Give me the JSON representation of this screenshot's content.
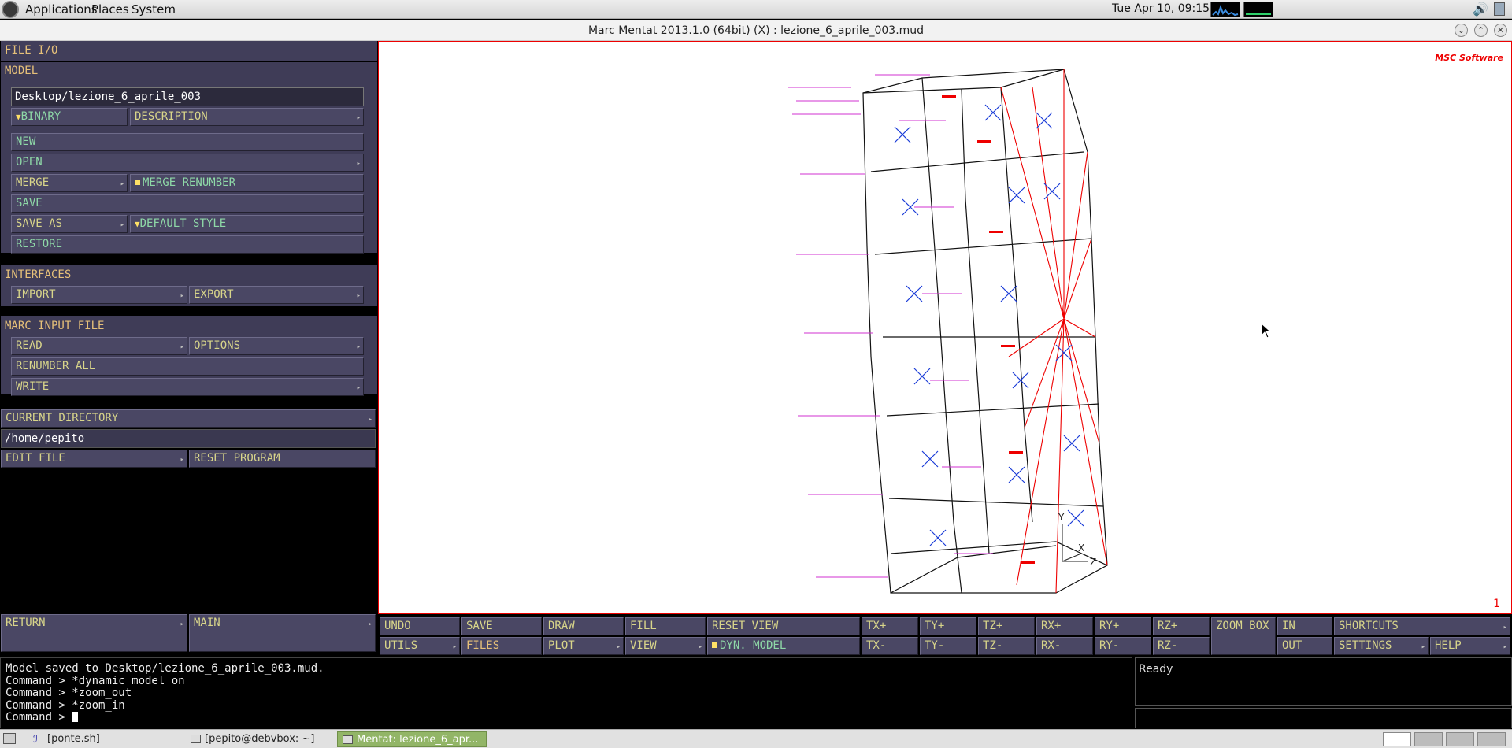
{
  "topbar": {
    "applications": "Applications",
    "places": "Places",
    "system": "System",
    "clock": "Tue Apr 10, 09:15"
  },
  "window": {
    "title": "Marc Mentat 2013.1.0 (64bit) (X) : lezione_6_aprile_003.mud"
  },
  "left": {
    "file_io": "FILE I/O",
    "model_header": "MODEL",
    "model_path": "Desktop/lezione_6_aprile_003",
    "binary": "BINARY",
    "description": "DESCRIPTION",
    "new": "NEW",
    "open": "OPEN",
    "merge": "MERGE",
    "merge_renumber": "MERGE RENUMBER",
    "save": "SAVE",
    "save_as": "SAVE AS",
    "default_style": "DEFAULT STYLE",
    "restore": "RESTORE",
    "interfaces_header": "INTERFACES",
    "import": "IMPORT",
    "export": "EXPORT",
    "marc_input_header": "MARC INPUT FILE",
    "read": "READ",
    "options": "OPTIONS",
    "renumber_all": "RENUMBER ALL",
    "write": "WRITE",
    "current_directory": "CURRENT DIRECTORY",
    "directory_path": "/home/pepito",
    "edit_file": "EDIT FILE",
    "reset_program": "RESET PROGRAM",
    "return": "RETURN",
    "main": "MAIN"
  },
  "viewport": {
    "logo": "MSC Software",
    "number": "1",
    "axis_y": "Y",
    "axis_x": "X",
    "axis_z": "Z"
  },
  "toolbar": {
    "undo": "UNDO",
    "save": "SAVE",
    "draw": "DRAW",
    "fill": "FILL",
    "reset_view": "RESET VIEW",
    "tx_plus": "TX+",
    "ty_plus": "TY+",
    "tz_plus": "TZ+",
    "rx_plus": "RX+",
    "ry_plus": "RY+",
    "rz_plus": "RZ+",
    "zoom_box": "ZOOM BOX",
    "in": "IN",
    "shortcuts": "SHORTCUTS",
    "utils": "UTILS",
    "files": "FILES",
    "plot": "PLOT",
    "view": "VIEW",
    "dyn_model": "DYN. MODEL",
    "tx_minus": "TX-",
    "ty_minus": "TY-",
    "tz_minus": "TZ-",
    "rx_minus": "RX-",
    "ry_minus": "RY-",
    "rz_minus": "RZ-",
    "out": "OUT",
    "settings": "SETTINGS",
    "help": "HELP"
  },
  "console": {
    "lines": [
      "Model saved to Desktop/lezione_6_aprile_003.mud.",
      "Command > *dynamic_model_on",
      "Command > *zoom_out",
      "Command > *zoom_in",
      "Command > "
    ]
  },
  "status": {
    "text": "Ready"
  },
  "taskbar": {
    "task1": "[ponte.sh]",
    "task2": "[pepito@debvbox: ~]",
    "task3": "Mentat: lezione_6_apr..."
  }
}
